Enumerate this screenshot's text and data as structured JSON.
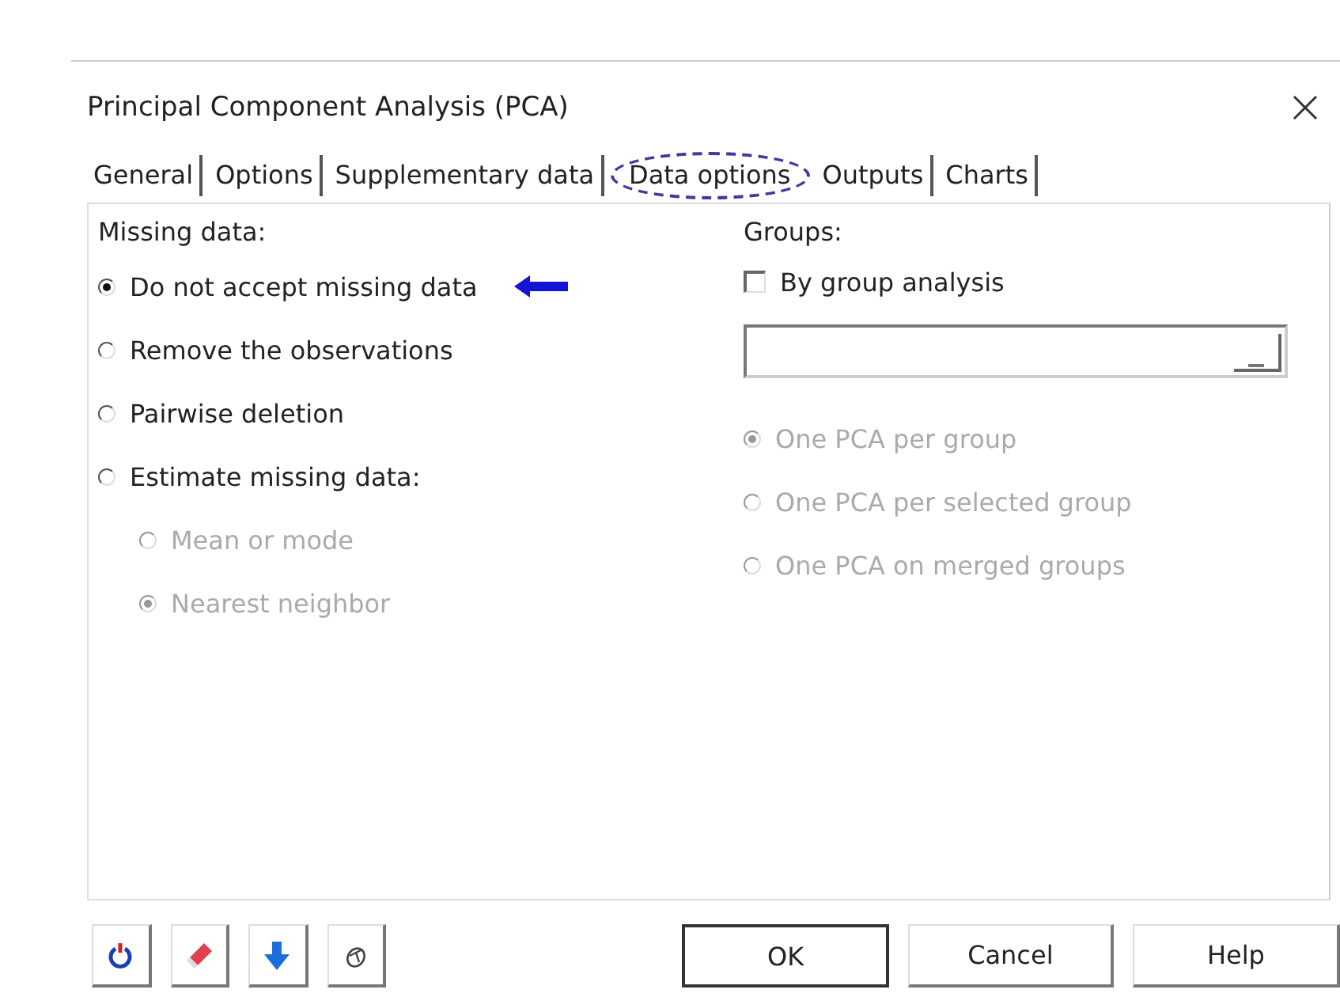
{
  "window": {
    "title": "Principal Component Analysis (PCA)"
  },
  "tabs": [
    {
      "label": "General",
      "selected": false
    },
    {
      "label": "Options",
      "selected": false
    },
    {
      "label": "Supplementary data",
      "selected": false
    },
    {
      "label": "Data options",
      "selected": true
    },
    {
      "label": "Outputs",
      "selected": false
    },
    {
      "label": "Charts",
      "selected": false
    }
  ],
  "missing_data": {
    "label": "Missing data:",
    "options": [
      {
        "label": "Do not accept missing data",
        "selected": true,
        "disabled": false
      },
      {
        "label": "Remove the observations",
        "selected": false,
        "disabled": false
      },
      {
        "label": "Pairwise deletion",
        "selected": false,
        "disabled": false
      },
      {
        "label": "Estimate missing data:",
        "selected": false,
        "disabled": false,
        "children": [
          {
            "label": "Mean or mode",
            "selected": false,
            "disabled": true
          },
          {
            "label": "Nearest neighbor",
            "selected": true,
            "disabled": true
          }
        ]
      }
    ]
  },
  "groups": {
    "label": "Groups:",
    "by_group": {
      "label": "By group analysis",
      "checked": false
    },
    "options": [
      {
        "label": "One PCA per group",
        "selected": true,
        "disabled": true
      },
      {
        "label": "One PCA per selected group",
        "selected": false,
        "disabled": true
      },
      {
        "label": "One PCA on merged groups",
        "selected": false,
        "disabled": true
      }
    ]
  },
  "buttons": [
    {
      "label": "OK",
      "default": true
    },
    {
      "label": "Cancel",
      "default": false
    },
    {
      "label": "Help",
      "default": false
    }
  ]
}
